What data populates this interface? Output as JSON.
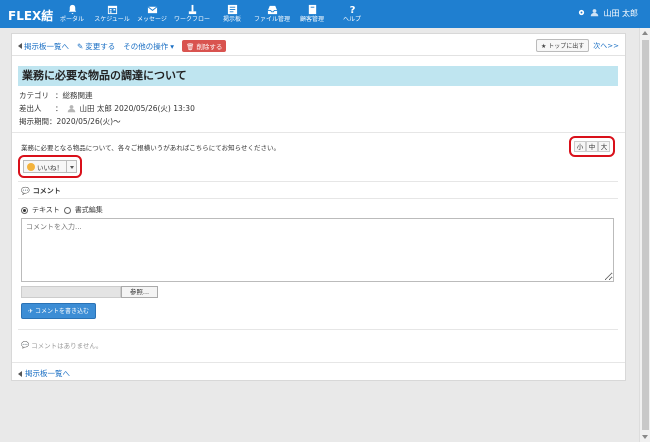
{
  "app": {
    "brand": "FLEX結"
  },
  "nav": [
    {
      "label": "ポータル",
      "icon": "bell-icon"
    },
    {
      "label": "スケジュール",
      "icon": "calendar-icon"
    },
    {
      "label": "メッセージ",
      "icon": "envelope-icon"
    },
    {
      "label": "ワークフロー",
      "icon": "workflow-icon"
    },
    {
      "label": "掲示板",
      "icon": "board-icon"
    },
    {
      "label": "ファイル管理",
      "icon": "inbox-icon"
    },
    {
      "label": "顧客管理",
      "icon": "book-icon"
    },
    {
      "label": "ヘルプ",
      "icon": "question-icon"
    }
  ],
  "user": {
    "name": "山田 太郎"
  },
  "toolbar": {
    "back": "掲示板一覧へ",
    "edit": "変更する",
    "other": "その他の操作",
    "delete": "削除する",
    "top": "トップに出す",
    "next": "次へ>>"
  },
  "post": {
    "title": "業務に必要な物品の調達について",
    "category_key": "カテゴリ",
    "category_val": "：総務関連",
    "sender_key": "差出人",
    "sender_val": "山田 太郎 2020/05/26(火) 13:30",
    "period_key": "掲示期間",
    "period_val": "：2020/05/26(火)〜",
    "body": "業務に必要となる物品について、各々ご根横いうがあればこちらにてお知らせください。"
  },
  "fontsize": {
    "small": "小",
    "medium": "中",
    "large": "大"
  },
  "like": {
    "label": "いいね！"
  },
  "comment": {
    "heading": "コメント",
    "mode_text": "テキスト",
    "mode_rich": "書式編集",
    "placeholder": "コメントを入力...",
    "browse": "参照...",
    "submit": "コメントを書き込む",
    "empty": "コメントはありません。"
  },
  "footer": {
    "back": "掲示板一覧へ"
  },
  "colors": {
    "nav_bg": "#1f7fd0",
    "title_bg": "#bfe5f0",
    "delete": "#d9534f",
    "highlight": "#d9101a"
  }
}
